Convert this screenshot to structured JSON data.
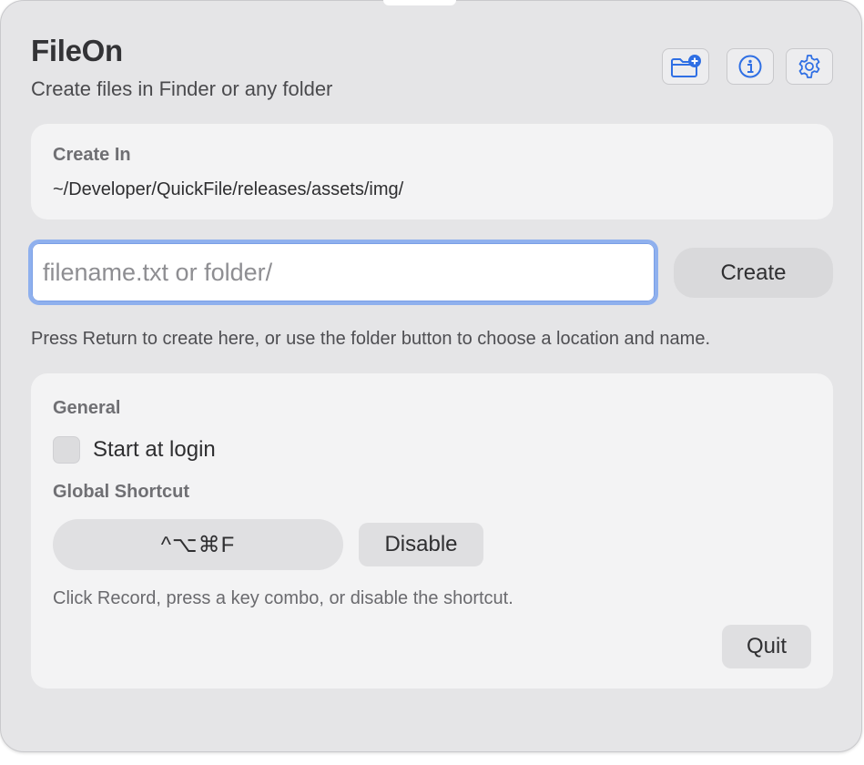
{
  "app": {
    "title": "FileOn",
    "subtitle": "Create files in Finder or any folder"
  },
  "toolbar": {
    "icons": [
      "folder-plus-icon",
      "info-icon",
      "gear-icon"
    ],
    "accent_color": "#2f6fe4"
  },
  "create_in": {
    "label": "Create In",
    "path": "~/Developer/QuickFile/releases/assets/img/"
  },
  "filename": {
    "value": "",
    "placeholder": "filename.txt or folder/"
  },
  "create_button": {
    "label": "Create"
  },
  "hint": "Press Return to create here, or use the folder button to choose a location and name.",
  "general": {
    "section_label": "General",
    "start_at_login": {
      "label": "Start at login",
      "checked": false
    },
    "shortcut_label": "Global Shortcut",
    "shortcut_value": "^⌥⌘F",
    "disable_label": "Disable",
    "shortcut_hint": "Click Record, press a key combo, or disable the shortcut.",
    "quit_label": "Quit"
  }
}
